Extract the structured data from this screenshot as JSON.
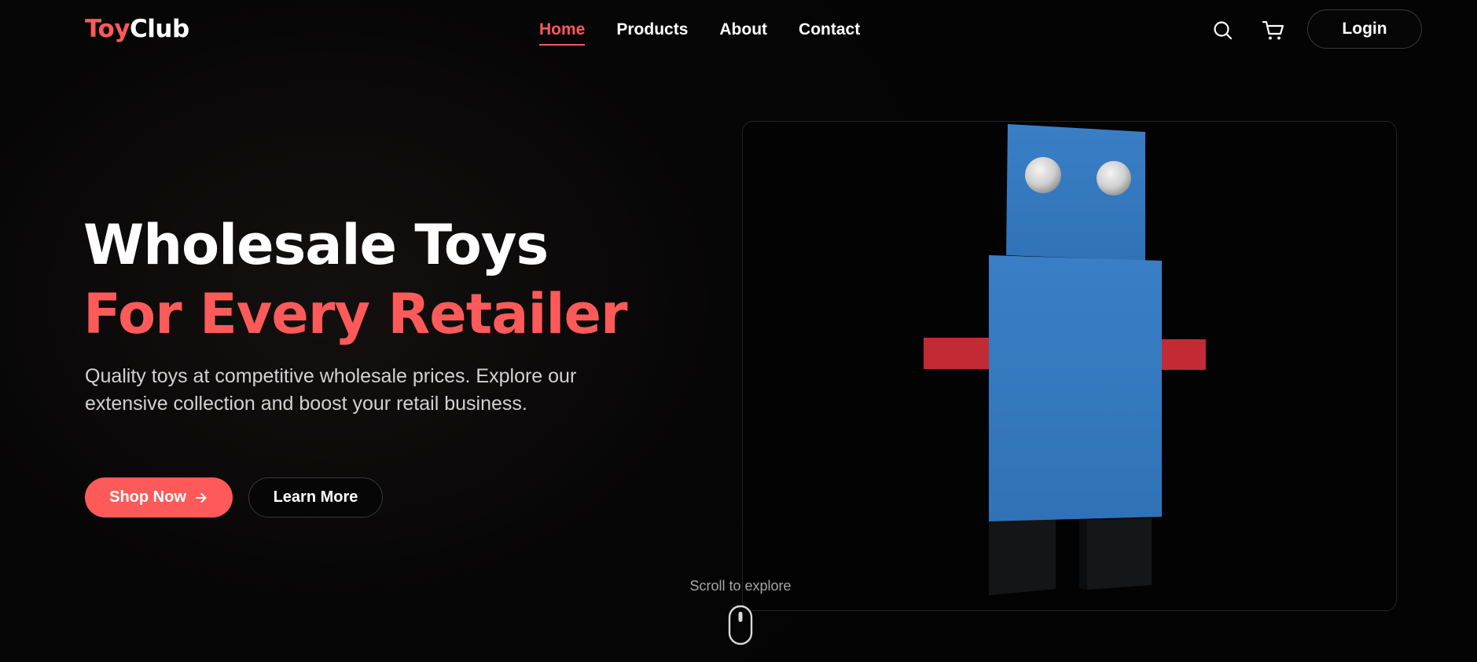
{
  "brand": {
    "logo_part1": "Toy",
    "logo_part2": "Club",
    "accent_color": "#ff5a5a"
  },
  "nav": {
    "items": [
      {
        "label": "Home",
        "active": true
      },
      {
        "label": "Products",
        "active": false
      },
      {
        "label": "About",
        "active": false
      },
      {
        "label": "Contact",
        "active": false
      }
    ]
  },
  "header_actions": {
    "search_icon": "search-icon",
    "cart_icon": "cart-icon",
    "login_label": "Login"
  },
  "hero": {
    "title_line1": "Wholesale Toys",
    "title_line2": "For Every Retailer",
    "description": "Quality toys at competitive wholesale prices. Explore our extensive collection and boost your retail business.",
    "primary_button": "Shop Now",
    "primary_button_icon": "arrow-right-icon",
    "secondary_button": "Learn More"
  },
  "viewer": {
    "model": "robot-toy",
    "body_color": "#3479c0",
    "arm_color": "#c22a35",
    "leg_color": "#141516",
    "eye_color": "#d8d8d8"
  },
  "scroll_hint": {
    "label": "Scroll to explore",
    "icon": "mouse-icon"
  }
}
